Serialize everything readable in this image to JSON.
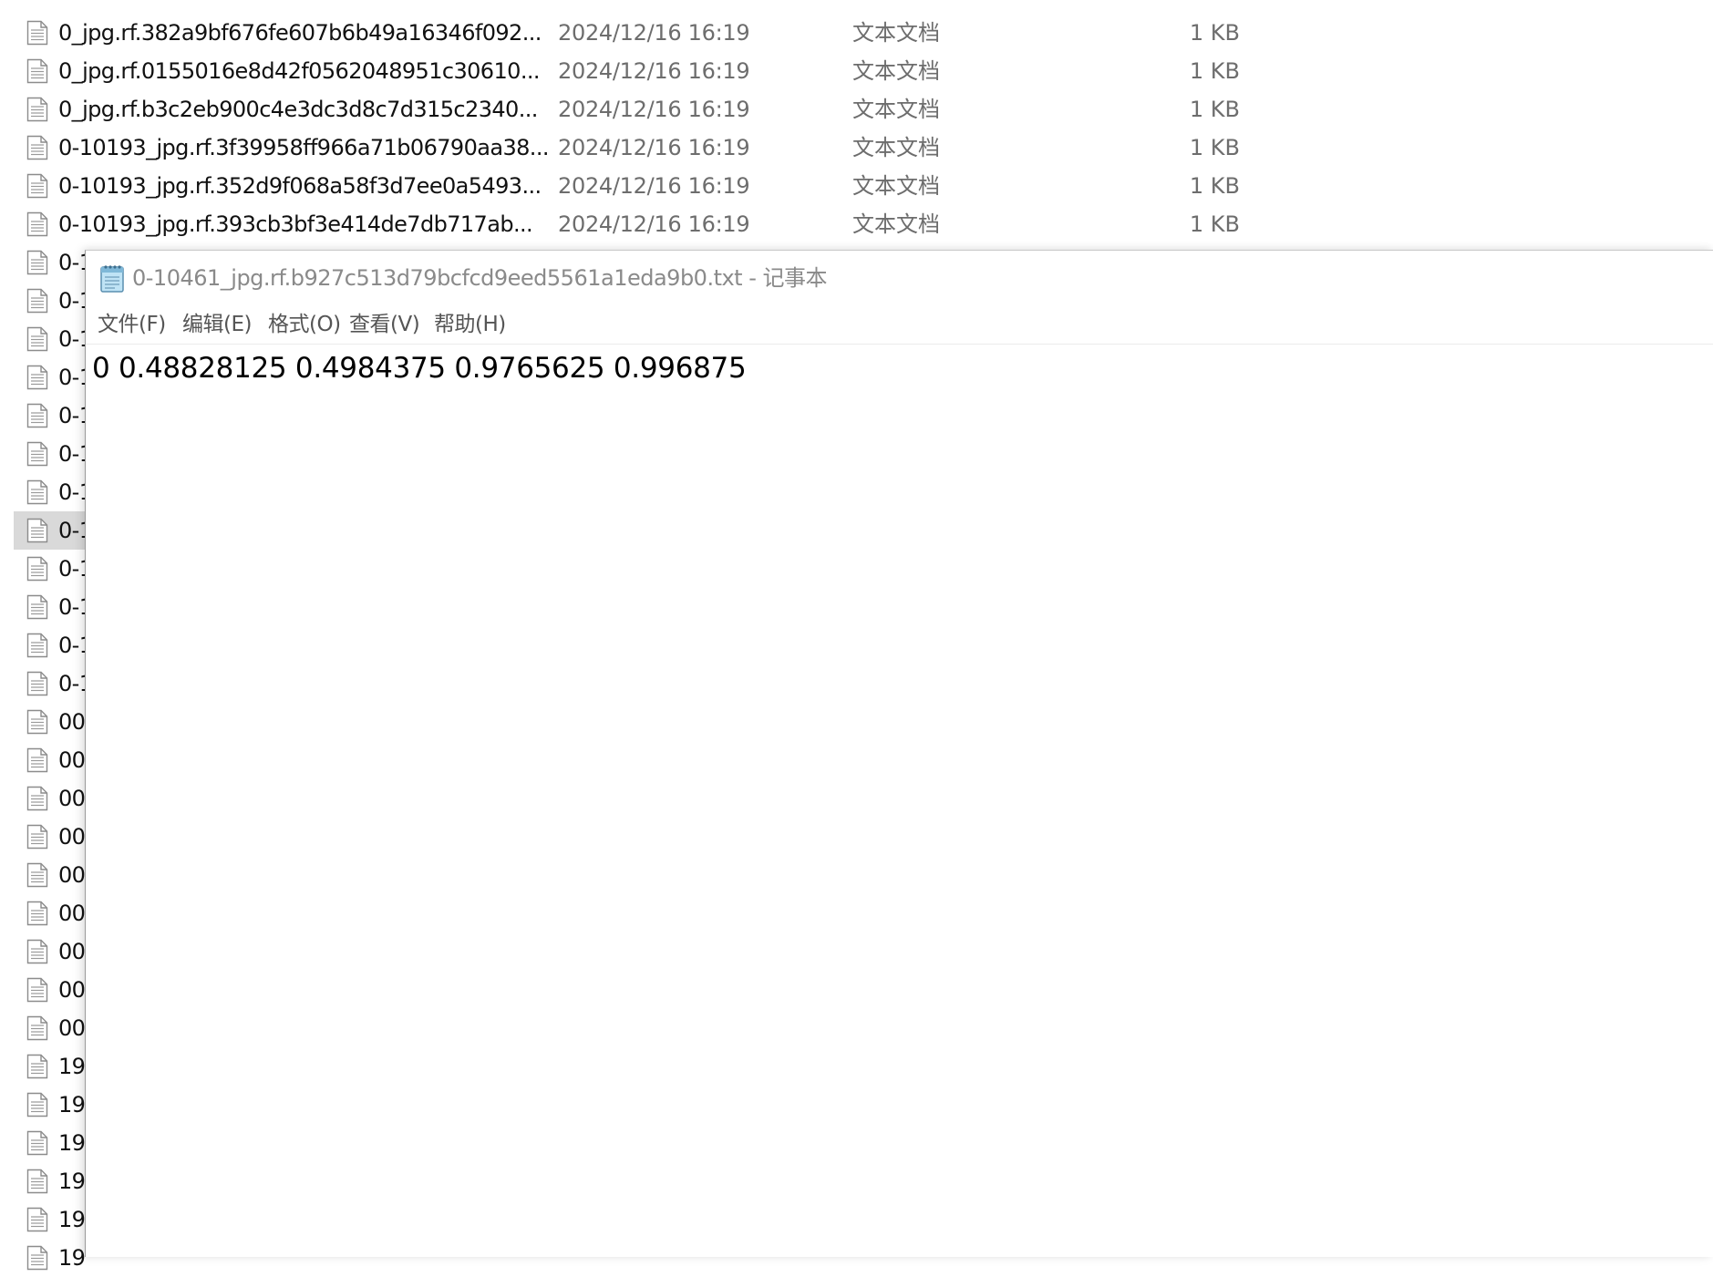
{
  "explorer": {
    "files": [
      {
        "name": "0_jpg.rf.382a9bf676fe607b6b49a16346f092...",
        "date": "2024/12/16 16:19",
        "type": "文本文档",
        "size": "1 KB"
      },
      {
        "name": "0_jpg.rf.0155016e8d42f0562048951c30610...",
        "date": "2024/12/16 16:19",
        "type": "文本文档",
        "size": "1 KB"
      },
      {
        "name": "0_jpg.rf.b3c2eb900c4e3dc3d8c7d315c2340...",
        "date": "2024/12/16 16:19",
        "type": "文本文档",
        "size": "1 KB"
      },
      {
        "name": "0-10193_jpg.rf.3f39958ff966a71b06790aa38...",
        "date": "2024/12/16 16:19",
        "type": "文本文档",
        "size": "1 KB"
      },
      {
        "name": "0-10193_jpg.rf.352d9f068a58f3d7ee0a5493...",
        "date": "2024/12/16 16:19",
        "type": "文本文档",
        "size": "1 KB"
      },
      {
        "name": "0-10193_jpg.rf.393cb3bf3e414de7db717ab...",
        "date": "2024/12/16 16:19",
        "type": "文本文档",
        "size": "1 KB"
      },
      {
        "name": "0-1"
      },
      {
        "name": "0-1"
      },
      {
        "name": "0-1"
      },
      {
        "name": "0-1"
      },
      {
        "name": "0-1"
      },
      {
        "name": "0-1"
      },
      {
        "name": "0-1"
      },
      {
        "name": "0-1",
        "selected": true
      },
      {
        "name": "0-1"
      },
      {
        "name": "0-1"
      },
      {
        "name": "0-1"
      },
      {
        "name": "0-1"
      },
      {
        "name": "00"
      },
      {
        "name": "00"
      },
      {
        "name": "00"
      },
      {
        "name": "00"
      },
      {
        "name": "00"
      },
      {
        "name": "00"
      },
      {
        "name": "00"
      },
      {
        "name": "00"
      },
      {
        "name": "00"
      },
      {
        "name": "19"
      },
      {
        "name": "19"
      },
      {
        "name": "19"
      },
      {
        "name": "19"
      },
      {
        "name": "19"
      },
      {
        "name": "19"
      }
    ]
  },
  "notepad": {
    "title": "0-10461_jpg.rf.b927c513d79bcfcd9eed5561a1eda9b0.txt - 记事本",
    "menu": {
      "file": "文件(F)",
      "edit": "编辑(E)",
      "format": "格式(O)",
      "view": "查看(V)",
      "help": "帮助(H)"
    },
    "content": "0 0.48828125 0.4984375 0.9765625 0.996875"
  },
  "icons": {
    "file_row_icon": "text-file-icon",
    "notepad_app_icon": "notepad-icon"
  }
}
